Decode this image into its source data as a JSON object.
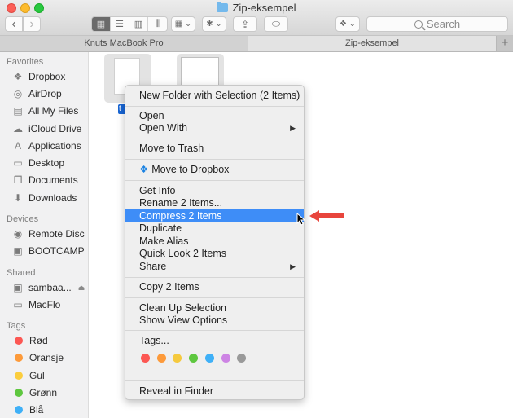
{
  "window": {
    "title": "Zip-eksempel"
  },
  "toolbar": {
    "back_label": "‹",
    "forward_label": "›",
    "views": [
      {
        "name": "icon-view",
        "glyph": "▦",
        "active": true
      },
      {
        "name": "list-view",
        "glyph": "☰",
        "active": false
      },
      {
        "name": "column-view",
        "glyph": "▥",
        "active": false
      },
      {
        "name": "cover-flow-view",
        "glyph": "⫼",
        "active": false
      }
    ],
    "arrange_glyph": "▦ ⌄",
    "action_glyph": "✱ ⌄",
    "share_glyph": "⇪",
    "tag_glyph": "⬭",
    "dropbox_glyph": "❖ ⌄",
    "search_placeholder": "Search"
  },
  "tabs": [
    {
      "label": "Knuts MacBook Pro",
      "active": false
    },
    {
      "label": "Zip-eksempel",
      "active": true
    }
  ],
  "tab_add_label": "+",
  "sidebar": {
    "favorites_title": "Favorites",
    "favorites": [
      {
        "label": "Dropbox",
        "icon": "dropbox-icon",
        "glyph": "❖"
      },
      {
        "label": "AirDrop",
        "icon": "airdrop-icon",
        "glyph": "◎"
      },
      {
        "label": "All My Files",
        "icon": "all-my-files-icon",
        "glyph": "▤"
      },
      {
        "label": "iCloud Drive",
        "icon": "icloud-icon",
        "glyph": "☁"
      },
      {
        "label": "Applications",
        "icon": "applications-icon",
        "glyph": "A"
      },
      {
        "label": "Desktop",
        "icon": "desktop-icon",
        "glyph": "▭"
      },
      {
        "label": "Documents",
        "icon": "documents-icon",
        "glyph": "❐"
      },
      {
        "label": "Downloads",
        "icon": "downloads-icon",
        "glyph": "⬇"
      }
    ],
    "devices_title": "Devices",
    "devices": [
      {
        "label": "Remote Disc",
        "icon": "remote-disc-icon",
        "glyph": "◉"
      },
      {
        "label": "BOOTCAMP",
        "icon": "drive-icon",
        "glyph": "▣"
      }
    ],
    "shared_title": "Shared",
    "shared": [
      {
        "label": "sambaa...",
        "icon": "server-icon",
        "glyph": "▣",
        "eject": "⏏"
      },
      {
        "label": "MacFlo",
        "icon": "laptop-icon",
        "glyph": "▭"
      }
    ],
    "tags_title": "Tags",
    "tags": [
      {
        "label": "Rød",
        "color": "#fc5753"
      },
      {
        "label": "Oransje",
        "color": "#fd9a3a"
      },
      {
        "label": "Gul",
        "color": "#fbcd3d"
      },
      {
        "label": "Grønn",
        "color": "#5ec73f"
      },
      {
        "label": "Blå",
        "color": "#3fb0f7"
      }
    ]
  },
  "files": {
    "selected_label_fragment": "t"
  },
  "context_menu": {
    "items": [
      {
        "label": "New Folder with Selection (2 Items)"
      },
      {
        "label": "Open"
      },
      {
        "label": "Open With",
        "submenu": "▶"
      },
      {
        "label": "Move to Trash"
      },
      {
        "label": "Move to Dropbox",
        "icon": "❖"
      },
      {
        "label": "Get Info"
      },
      {
        "label": "Rename 2 Items..."
      },
      {
        "label": "Compress 2 Items",
        "highlighted": true
      },
      {
        "label": "Duplicate"
      },
      {
        "label": "Make Alias"
      },
      {
        "label": "Quick Look 2 Items"
      },
      {
        "label": "Share",
        "submenu": "▶"
      },
      {
        "label": "Copy 2 Items"
      },
      {
        "label": "Clean Up Selection"
      },
      {
        "label": "Show View Options"
      },
      {
        "label": "Tags..."
      },
      {
        "label": "Reveal in Finder"
      }
    ],
    "tag_colors": [
      "#fc5753",
      "#fd9a3a",
      "#f5c93e",
      "#5ec73f",
      "#3fb0f7",
      "#cd84e4",
      "#999999"
    ],
    "highlight_color": "#3e8df7"
  },
  "annotation": {
    "arrow_color": "#e8453c"
  }
}
